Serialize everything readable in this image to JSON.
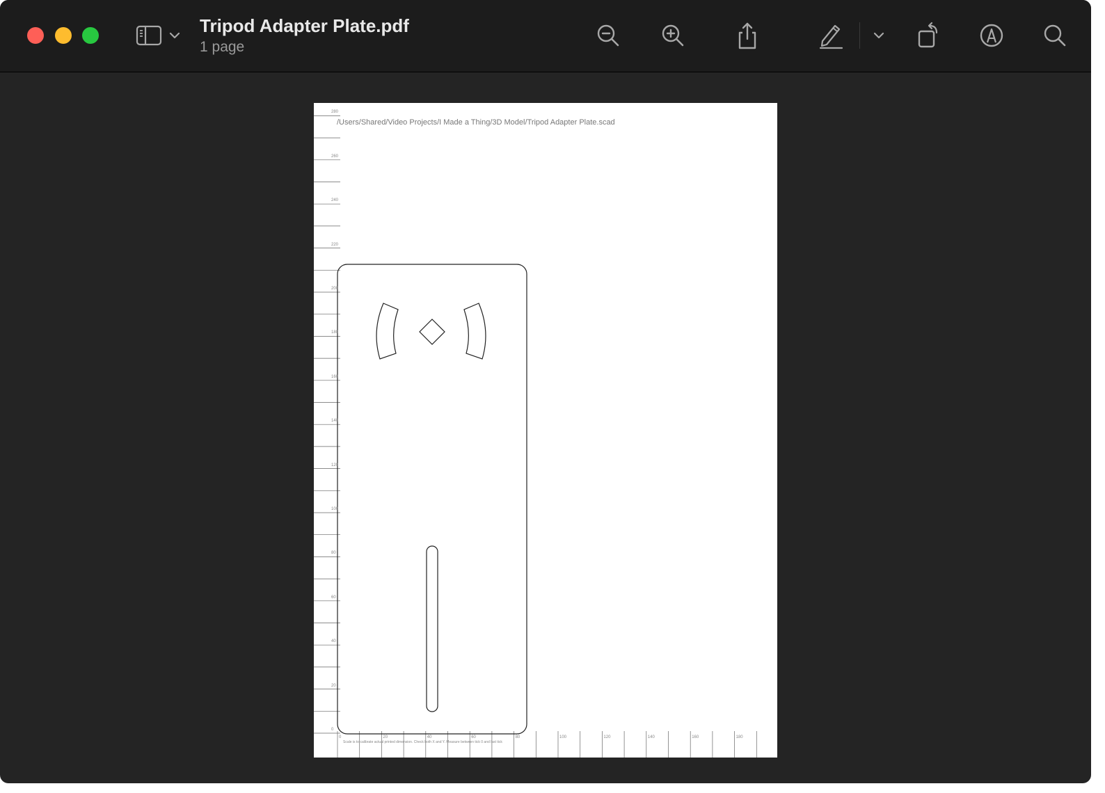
{
  "window": {
    "title": "Tripod Adapter Plate.pdf",
    "subtitle": "1 page"
  },
  "toolbar": {
    "icons": [
      "sidebar-icon",
      "chevron-down-icon",
      "zoom-out-icon",
      "zoom-in-icon",
      "share-icon",
      "markup-pencil-icon",
      "chevron-down-icon",
      "rotate-icon",
      "annotate-icon",
      "search-icon"
    ]
  },
  "document": {
    "file_path": "/Users/Shared/Video Projects/I Made a Thing/3D Model/Tripod Adapter Plate.scad",
    "scale_note": "Scale is to calibrate actual printed dimension. Check both X and Y. Measure between tick 0 and last tick",
    "y_ruler_labels": [
      "280",
      "260",
      "240",
      "220",
      "200",
      "180",
      "160",
      "140",
      "120",
      "100",
      "80",
      "60",
      "40",
      "20",
      "0"
    ],
    "x_ruler_labels": [
      "0",
      "20",
      "40",
      "60",
      "80",
      "100",
      "120",
      "140",
      "160",
      "180"
    ]
  },
  "colors": {
    "window_bg": "#242424",
    "toolbar_bg": "#1c1c1c",
    "close": "#fe5f57",
    "minimize": "#febc2e",
    "maximize": "#28c840"
  }
}
